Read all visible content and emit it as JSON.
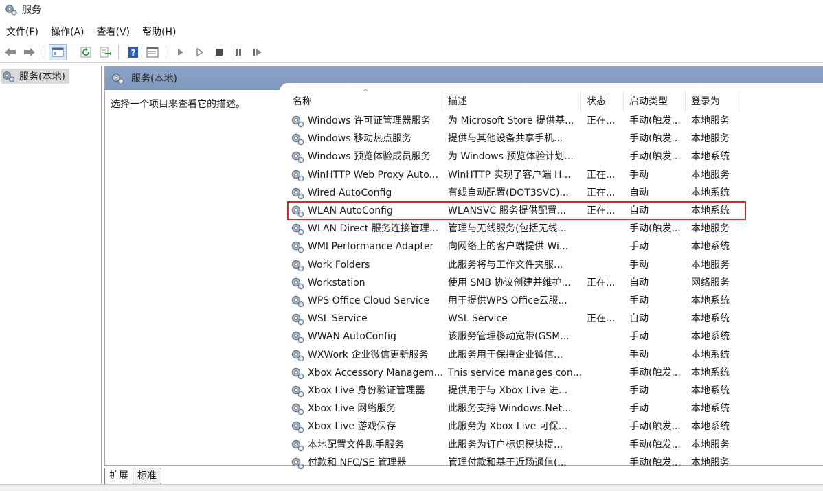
{
  "window": {
    "title": "服务"
  },
  "menu": [
    "文件(F)",
    "操作(A)",
    "查看(V)",
    "帮助(H)"
  ],
  "toolbar": {
    "buttons": [
      "back-icon",
      "forward-icon",
      "show-hide-tree-icon",
      "refresh-icon",
      "export-list-icon",
      "help-icon",
      "properties-icon",
      "start-service-icon",
      "start-service-alt-icon",
      "stop-service-icon",
      "pause-service-icon",
      "resume-service-icon"
    ]
  },
  "tree": {
    "root_label": "服务(本地)"
  },
  "pane": {
    "header_label": "服务(本地)",
    "description_hint": "选择一个项目来查看它的描述。"
  },
  "table": {
    "columns": [
      "名称",
      "描述",
      "状态",
      "启动类型",
      "登录为"
    ],
    "rows": [
      {
        "name": "Windows 许可证管理器服务",
        "desc": "为 Microsoft Store 提供基...",
        "state": "正在...",
        "start": "手动(触发...",
        "logon": "本地服务"
      },
      {
        "name": "Windows 移动热点服务",
        "desc": "提供与其他设备共享手机...",
        "state": "",
        "start": "手动(触发...",
        "logon": "本地服务"
      },
      {
        "name": "Windows 预览体验成员服务",
        "desc": "为 Windows 预览体验计划...",
        "state": "",
        "start": "手动(触发...",
        "logon": "本地系统"
      },
      {
        "name": "WinHTTP Web Proxy Auto...",
        "desc": "WinHTTP 实现了客户端 H...",
        "state": "正在...",
        "start": "手动",
        "logon": "本地服务"
      },
      {
        "name": "Wired AutoConfig",
        "desc": "有线自动配置(DOT3SVC)...",
        "state": "正在...",
        "start": "自动",
        "logon": "本地系统"
      },
      {
        "name": "WLAN AutoConfig",
        "desc": "WLANSVC 服务提供配置...",
        "state": "正在...",
        "start": "自动",
        "logon": "本地系统"
      },
      {
        "name": "WLAN Direct 服务连接管理...",
        "desc": "管理与无线服务(包括无线...",
        "state": "",
        "start": "手动(触发...",
        "logon": "本地服务"
      },
      {
        "name": "WMI Performance Adapter",
        "desc": "向网络上的客户端提供 Wi...",
        "state": "",
        "start": "手动",
        "logon": "本地系统"
      },
      {
        "name": "Work Folders",
        "desc": "此服务将与工作文件夹服...",
        "state": "",
        "start": "手动",
        "logon": "本地服务"
      },
      {
        "name": "Workstation",
        "desc": "使用 SMB 协议创建并维护...",
        "state": "正在...",
        "start": "自动",
        "logon": "网络服务"
      },
      {
        "name": "WPS Office Cloud Service",
        "desc": "用于提供WPS Office云服...",
        "state": "",
        "start": "手动",
        "logon": "本地系统"
      },
      {
        "name": "WSL Service",
        "desc": "WSL Service",
        "state": "正在...",
        "start": "自动",
        "logon": "本地系统"
      },
      {
        "name": "WWAN AutoConfig",
        "desc": "该服务管理移动宽带(GSM...",
        "state": "",
        "start": "手动",
        "logon": "本地系统"
      },
      {
        "name": "WXWork 企业微信更新服务",
        "desc": "此服务用于保持企业微信...",
        "state": "",
        "start": "手动",
        "logon": "本地系统"
      },
      {
        "name": "Xbox Accessory Managem...",
        "desc": "This service manages con...",
        "state": "",
        "start": "手动(触发...",
        "logon": "本地系统"
      },
      {
        "name": "Xbox Live 身份验证管理器",
        "desc": "提供用于与 Xbox Live 进...",
        "state": "",
        "start": "手动",
        "logon": "本地系统"
      },
      {
        "name": "Xbox Live 网络服务",
        "desc": "此服务支持 Windows.Net...",
        "state": "",
        "start": "手动",
        "logon": "本地系统"
      },
      {
        "name": "Xbox Live 游戏保存",
        "desc": "此服务为 Xbox Live 可保...",
        "state": "",
        "start": "手动(触发...",
        "logon": "本地系统"
      },
      {
        "name": "本地配置文件助手服务",
        "desc": "此服务为订户标识模块提...",
        "state": "",
        "start": "手动(触发...",
        "logon": "本地服务"
      },
      {
        "name": "付款和 NFC/SE 管理器",
        "desc": "管理付款和基于近场通信(...",
        "state": "",
        "start": "手动(触发...",
        "logon": "本地服务"
      }
    ],
    "highlighted_row": "WLAN AutoConfig"
  },
  "bottom_tabs": [
    "扩展",
    "标准"
  ],
  "colors": {
    "highlight_box": "#d12a2a",
    "pane_header": "#8ba3c6"
  }
}
